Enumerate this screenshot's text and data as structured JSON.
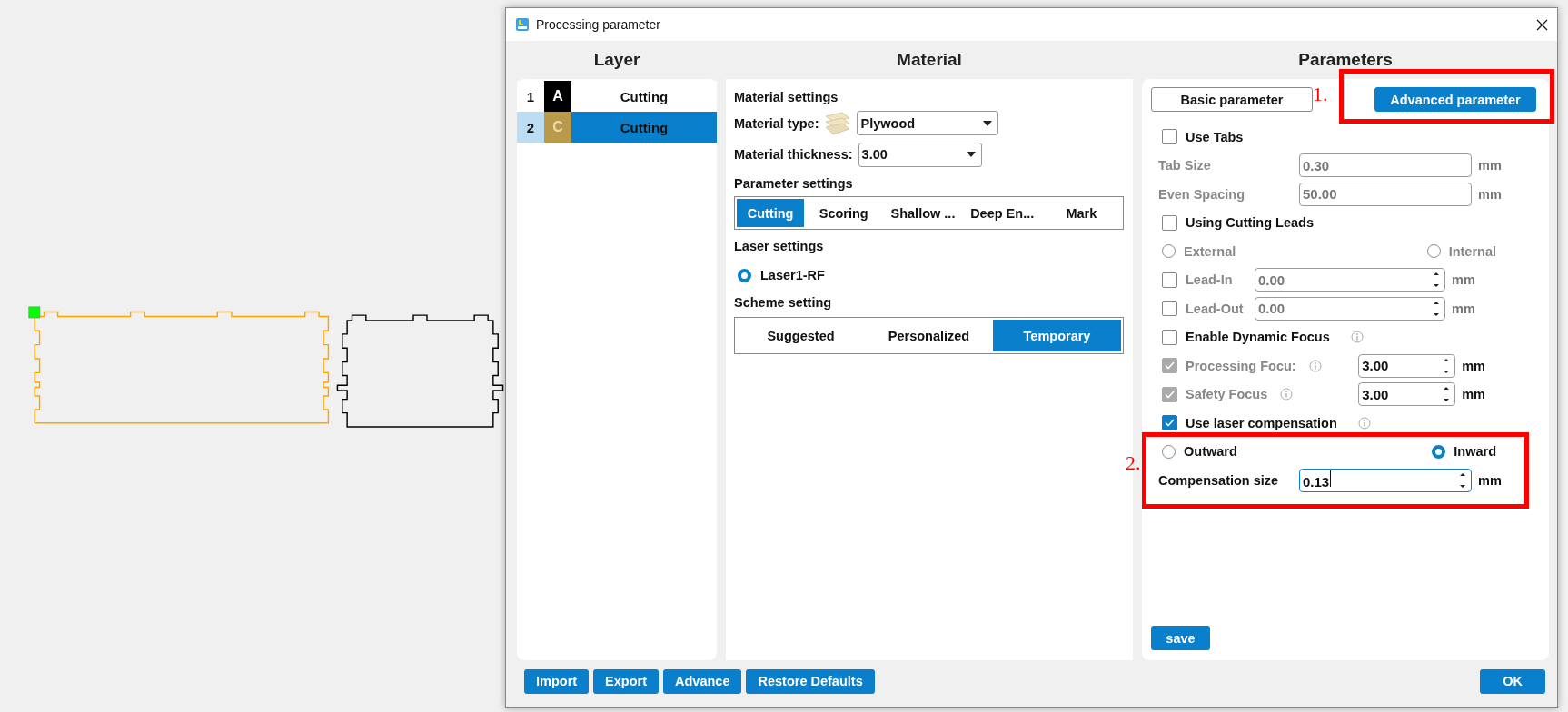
{
  "dialog": {
    "title": "Processing parameter",
    "layer": {
      "heading": "Layer",
      "rows": [
        {
          "number": "1",
          "letter": "A",
          "color": "#000000",
          "mode": "Cutting",
          "selected": false
        },
        {
          "number": "2",
          "letter": "C",
          "color": "#b89a4a",
          "mode": "Cutting",
          "selected": true
        }
      ]
    },
    "material": {
      "heading": "Material",
      "settings_label": "Material settings",
      "type": {
        "label": "Material type:",
        "value": "Plywood"
      },
      "thickness": {
        "label": "Material thickness:",
        "value": "3.00"
      },
      "parameter_settings": {
        "label": "Parameter settings",
        "tabs": [
          {
            "label": "Cutting",
            "selected": true
          },
          {
            "label": "Scoring",
            "selected": false
          },
          {
            "label": "Shallow ...",
            "selected": false
          },
          {
            "label": "Deep En...",
            "selected": false
          },
          {
            "label": "Mark",
            "selected": false
          }
        ]
      },
      "laser_settings": {
        "label": "Laser settings",
        "options": [
          {
            "label": "Laser1-RF",
            "selected": true
          }
        ]
      },
      "scheme": {
        "label": "Scheme setting",
        "tabs": [
          {
            "label": "Suggested",
            "selected": false
          },
          {
            "label": "Personalized",
            "selected": false
          },
          {
            "label": "Temporary",
            "selected": true
          }
        ]
      }
    },
    "parameters": {
      "heading": "Parameters",
      "tabs": [
        {
          "label": "Basic parameter",
          "selected": false
        },
        {
          "label": "Advanced parameter",
          "selected": true
        }
      ],
      "rows": [
        {
          "kind": "checkbox",
          "label": "Use Tabs",
          "checked": false
        },
        {
          "kind": "field",
          "label": "Tab Size",
          "value": "0.30",
          "unit": "mm",
          "disabled": true
        },
        {
          "kind": "field",
          "label": "Even Spacing",
          "value": "50.00",
          "unit": "mm",
          "disabled": true
        },
        {
          "kind": "checkbox",
          "label": "Using Cutting Leads",
          "checked": false
        },
        {
          "kind": "radios",
          "disabled": true,
          "options": [
            {
              "label": "External",
              "selected": false
            },
            {
              "label": "Internal",
              "selected": false
            }
          ]
        },
        {
          "kind": "check_field",
          "label": "Lead-In",
          "checked": false,
          "disabled": true,
          "value": "0.00",
          "unit": "mm"
        },
        {
          "kind": "check_field",
          "label": "Lead-Out",
          "checked": false,
          "disabled": true,
          "value": "0.00",
          "unit": "mm"
        },
        {
          "kind": "checkbox",
          "label": "Enable Dynamic Focus",
          "checked": false,
          "info": true
        },
        {
          "kind": "focus_field",
          "label": "Processing Focu:",
          "checked": true,
          "disabled": true,
          "value": "3.00",
          "unit": "mm"
        },
        {
          "kind": "focus_field",
          "label": "Safety Focus",
          "checked": true,
          "disabled": true,
          "value": "3.00",
          "unit": "mm"
        },
        {
          "kind": "checkbox",
          "label": "Use laser compensation",
          "checked": true,
          "info": true
        },
        {
          "kind": "radios",
          "options": [
            {
              "label": "Outward",
              "selected": false
            },
            {
              "label": "Inward",
              "selected": true
            }
          ]
        },
        {
          "kind": "spin_field",
          "label": "Compensation size",
          "value": "0.13",
          "unit": "mm",
          "focused": true
        }
      ],
      "save": "save"
    },
    "annotations": [
      "1.",
      "2."
    ],
    "footer_buttons": [
      "Import",
      "Export",
      "Advance",
      "Restore Defaults"
    ],
    "ok": "OK"
  }
}
